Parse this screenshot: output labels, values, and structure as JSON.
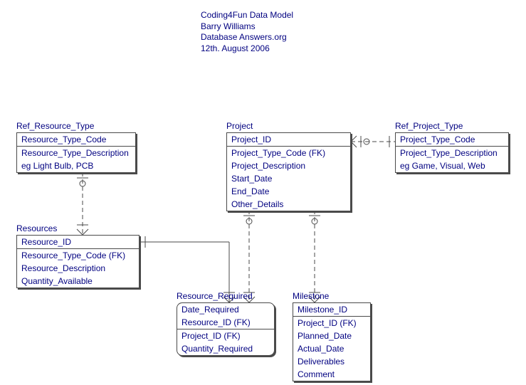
{
  "header": {
    "line1": "Coding4Fun Data Model",
    "line2": "Barry Williams",
    "line3": "Database Answers.org",
    "line4": "12th. August 2006"
  },
  "entities": {
    "ref_resource_type": {
      "label": "Ref_Resource_Type",
      "pk": [
        "Resource_Type_Code"
      ],
      "attrs": [
        "Resource_Type_Description",
        "eg Light Bulb, PCB"
      ]
    },
    "resources": {
      "label": "Resources",
      "pk": [
        "Resource_ID"
      ],
      "attrs": [
        "Resource_Type_Code (FK)",
        "Resource_Description",
        "Quantity_Available"
      ]
    },
    "project": {
      "label": "Project",
      "pk": [
        "Project_ID"
      ],
      "attrs": [
        "Project_Type_Code (FK)",
        "Project_Description",
        "Start_Date",
        "End_Date",
        "Other_Details"
      ]
    },
    "ref_project_type": {
      "label": "Ref_Project_Type",
      "pk": [
        "Project_Type_Code"
      ],
      "attrs": [
        "Project_Type_Description",
        "eg Game, Visual, Web"
      ]
    },
    "resource_required": {
      "label": "Resource_Required",
      "pk": [
        "Date_Required",
        "Resource_ID (FK)"
      ],
      "attrs": [
        "Project_ID (FK)",
        "Quantity_Required"
      ]
    },
    "milestone": {
      "label": "Milestone",
      "pk": [
        "Milestone_ID"
      ],
      "attrs": [
        "Project_ID (FK)",
        "Planned_Date",
        "Actual_Date",
        "Deliverables",
        "Comment"
      ]
    }
  },
  "chart_data": {
    "type": "diagram",
    "title": "Coding4Fun Data Model",
    "diagram_type": "entity-relationship",
    "entities": [
      {
        "name": "Ref_Resource_Type",
        "primary_key": [
          "Resource_Type_Code"
        ],
        "attributes": [
          "Resource_Type_Description"
        ],
        "note": "eg Light Bulb, PCB"
      },
      {
        "name": "Resources",
        "primary_key": [
          "Resource_ID"
        ],
        "attributes": [
          "Resource_Type_Code (FK)",
          "Resource_Description",
          "Quantity_Available"
        ]
      },
      {
        "name": "Project",
        "primary_key": [
          "Project_ID"
        ],
        "attributes": [
          "Project_Type_Code (FK)",
          "Project_Description",
          "Start_Date",
          "End_Date",
          "Other_Details"
        ]
      },
      {
        "name": "Ref_Project_Type",
        "primary_key": [
          "Project_Type_Code"
        ],
        "attributes": [
          "Project_Type_Description"
        ],
        "note": "eg Game, Visual, Web"
      },
      {
        "name": "Resource_Required",
        "primary_key": [
          "Date_Required",
          "Resource_ID (FK)"
        ],
        "attributes": [
          "Project_ID (FK)",
          "Quantity_Required"
        ]
      },
      {
        "name": "Milestone",
        "primary_key": [
          "Milestone_ID"
        ],
        "attributes": [
          "Project_ID (FK)",
          "Planned_Date",
          "Actual_Date",
          "Deliverables",
          "Comment"
        ]
      }
    ],
    "relationships": [
      {
        "from": "Ref_Resource_Type",
        "to": "Resources",
        "type": "one-to-many",
        "identifying": false
      },
      {
        "from": "Resources",
        "to": "Resource_Required",
        "type": "one-to-many",
        "identifying": true
      },
      {
        "from": "Project",
        "to": "Resource_Required",
        "type": "one-to-many",
        "identifying": false
      },
      {
        "from": "Project",
        "to": "Milestone",
        "type": "one-to-many",
        "identifying": false
      },
      {
        "from": "Ref_Project_Type",
        "to": "Project",
        "type": "one-to-many",
        "identifying": false
      }
    ]
  }
}
